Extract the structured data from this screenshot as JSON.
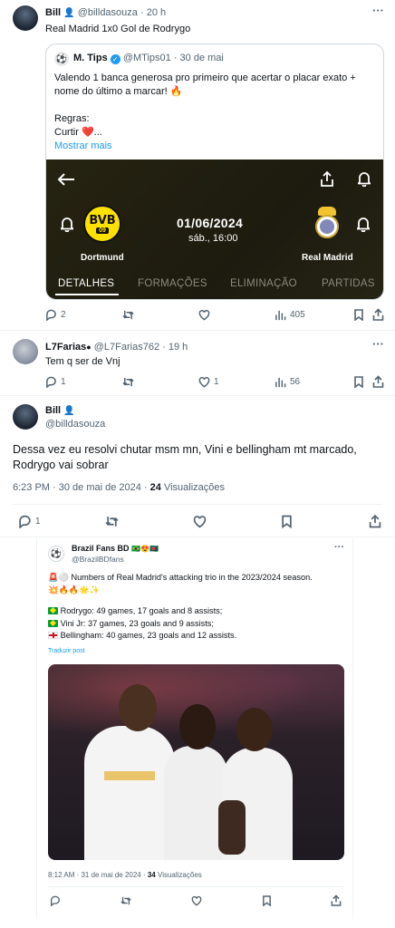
{
  "tweet1": {
    "author_name": "Bill",
    "author_handle": "@billdasouza",
    "time": "· 20 h",
    "text": "Real Madrid 1x0 Gol de Rodrygo",
    "quote": {
      "author_name": "M. Tips",
      "author_handle": "@MTips01",
      "time": "· 30 de mai",
      "line1": "Valendo 1 banca generosa pro primeiro que acertar o placar exato +",
      "line2": "nome do último a marcar! 🔥",
      "line3": "Regras:",
      "line4": "Curtir ❤️...",
      "show_more": "Mostrar mais",
      "match": {
        "date": "01/06/2024",
        "day_time": "sáb., 16:00",
        "home_team": "Dortmund",
        "away_team": "Real Madrid",
        "home_badge": "BVB",
        "home_badge_num": "09",
        "tabs": [
          "DETALHES",
          "FORMAÇÕES",
          "ELIMINAÇÃO",
          "PARTIDAS"
        ]
      }
    },
    "actions": {
      "replies": "2",
      "retweets": "",
      "likes": "",
      "views": "405"
    }
  },
  "tweet2": {
    "author_name": "L7Farias",
    "author_handle": "@L7Farias762",
    "time": "· 19 h",
    "text": "Tem q ser de Vnj",
    "actions": {
      "replies": "1",
      "retweets": "",
      "likes": "1",
      "views": "56"
    }
  },
  "tweet3": {
    "author_name": "Bill",
    "author_handle": "@billdasouza",
    "text_line1": "Dessa vez eu resolvi chutar msm mn, Vini e bellingham mt marcado,",
    "text_line2": "Rodrygo vai sobrar",
    "time": "6:23 PM · 30 de mai de 2024 ·",
    "views_count": "24",
    "views_label": "Visualizações",
    "actions": {
      "replies": "1"
    }
  },
  "embed": {
    "author_name": "Brazil Fans BD",
    "emoji": "🇧🇷😍🇧🇩",
    "author_handle": "@BrazilBDfans",
    "line1": "Numbers of Real Madrid's attacking trio in the 2023/2024 season.",
    "line2": "💥🔥🔥🌟✨",
    "stat1": "Rodrygo: 49 games, 17 goals and 8 assists;",
    "stat2": "Vini Jr: 37 games, 23 goals and 9 assists;",
    "stat3": "Bellingham: 40 games, 23 goals and 12 assists.",
    "translate": "Traduzir post",
    "time": "8:12 AM · 31 de mai de 2024 ·",
    "views_count": "34",
    "views_label": "Visualizações"
  },
  "colors": {
    "accent": "#1d9bf0",
    "muted": "#536471",
    "match_bg": "#1f1d10",
    "bvb_yellow": "#fde100"
  }
}
